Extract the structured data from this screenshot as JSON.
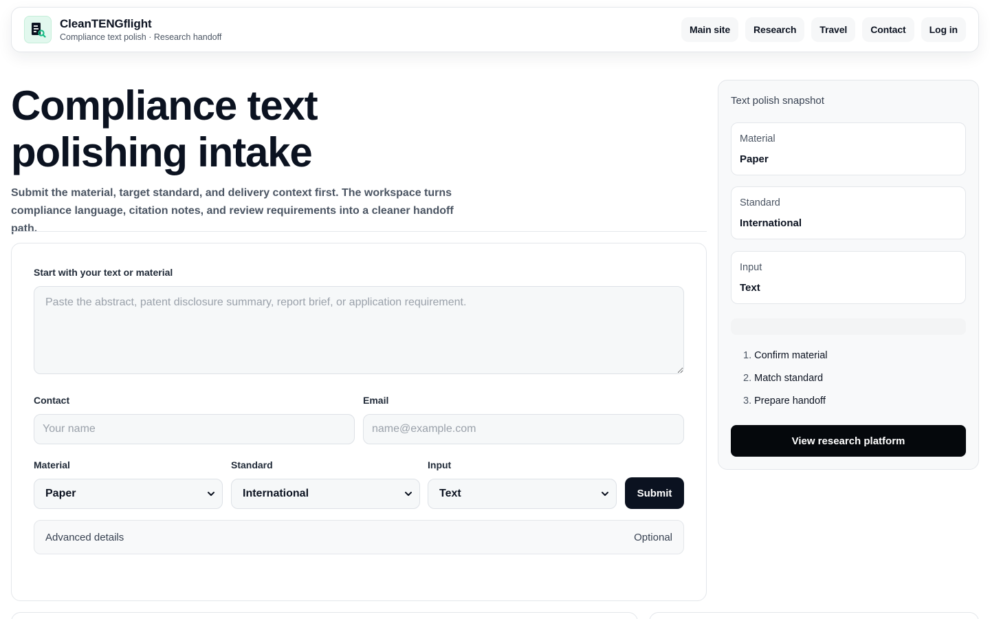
{
  "header": {
    "brand_name": "CleanTENGflight",
    "brand_subtitle": "Compliance text polish · Research handoff",
    "nav": [
      "Main site",
      "Research",
      "Travel",
      "Contact",
      "Log in"
    ]
  },
  "hero": {
    "title_line1": "Compliance text",
    "title_line2": "polishing intake",
    "description": "Submit the material, target standard, and delivery context first. The workspace turns compliance language, citation notes, and review requirements into a cleaner handoff path."
  },
  "form": {
    "text_label": "Start with your text or material",
    "text_placeholder": "Paste the abstract, patent disclosure summary, report brief, or application requirement.",
    "contact_label": "Contact",
    "contact_placeholder": "Your name",
    "email_label": "Email",
    "email_placeholder": "name@example.com",
    "material_label": "Material",
    "material_value": "Paper",
    "standard_label": "Standard",
    "standard_value": "International",
    "input_label": "Input",
    "input_value": "Text",
    "submit_label": "Submit",
    "advanced_label": "Advanced details",
    "advanced_hint": "Optional"
  },
  "sidebar": {
    "title": "Text polish snapshot",
    "snapshot": [
      {
        "label": "Material",
        "value": "Paper"
      },
      {
        "label": "Standard",
        "value": "International"
      },
      {
        "label": "Input",
        "value": "Text"
      }
    ],
    "steps": [
      {
        "num": "1.",
        "text": "Confirm material"
      },
      {
        "num": "2.",
        "text": "Match standard"
      },
      {
        "num": "3.",
        "text": "Prepare handoff"
      }
    ],
    "cta_label": "View research platform"
  },
  "colors": {
    "primary_dark": "#0b1220",
    "logo_bg": "#e2f8ee",
    "logo_accent": "#10b981"
  }
}
